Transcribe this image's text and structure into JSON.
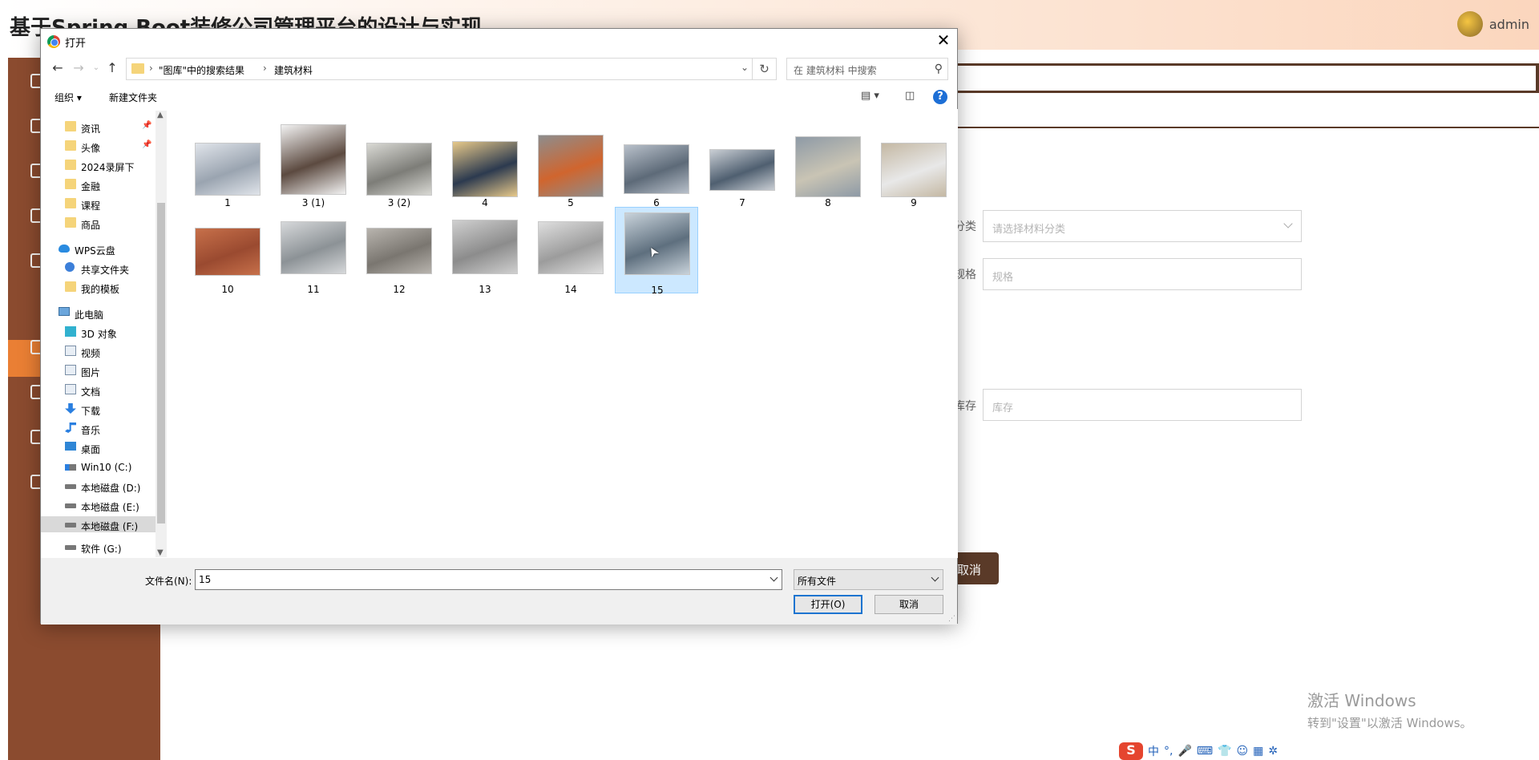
{
  "app": {
    "title": "基于Spring Boot装修公司管理平台的设计与实现",
    "user": "admin"
  },
  "form": {
    "category_label": "分类",
    "category_placeholder": "请选择材料分类",
    "spec_label": "规格",
    "spec_placeholder": "规格",
    "stock_label": "库存",
    "stock_placeholder": "库存",
    "cancel_label": "取消"
  },
  "watermark": {
    "line1": "激活 Windows",
    "line2": "转到\"设置\"以激活 Windows。"
  },
  "ime": {
    "logo": "S",
    "mode": "中",
    "punct": "°,",
    "icons": [
      "microphone-icon",
      "keyboard-icon",
      "shirt-icon",
      "robot-icon",
      "grid-icon",
      "settings-icon"
    ]
  },
  "dialog": {
    "title": "打开",
    "address": {
      "segment1": "\"图库\"中的搜索结果",
      "segment2": "建筑材料"
    },
    "search_placeholder": "在 建筑材料 中搜索",
    "toolbar": {
      "organize": "组织",
      "new_folder": "新建文件夹"
    },
    "tree": [
      {
        "label": "资讯",
        "icon": "folder-icon",
        "pinned": true
      },
      {
        "label": "头像",
        "icon": "folder-icon",
        "pinned": true
      },
      {
        "label": "2024录屏下",
        "icon": "folder-icon"
      },
      {
        "label": "金融",
        "icon": "folder-icon"
      },
      {
        "label": "课程",
        "icon": "folder-icon"
      },
      {
        "label": "商品",
        "icon": "folder-icon"
      },
      {
        "label": "WPS云盘",
        "icon": "cloud-icon"
      },
      {
        "label": "共享文件夹",
        "icon": "share-icon"
      },
      {
        "label": "我的模板",
        "icon": "folder-icon"
      },
      {
        "label": "此电脑",
        "icon": "pc-icon"
      },
      {
        "label": "3D 对象",
        "icon": "cube-icon"
      },
      {
        "label": "视频",
        "icon": "video-icon"
      },
      {
        "label": "图片",
        "icon": "pictures-icon"
      },
      {
        "label": "文档",
        "icon": "documents-icon"
      },
      {
        "label": "下载",
        "icon": "download-icon"
      },
      {
        "label": "音乐",
        "icon": "music-icon"
      },
      {
        "label": "桌面",
        "icon": "desktop-icon"
      },
      {
        "label": "Win10 (C:)",
        "icon": "system-drive-icon"
      },
      {
        "label": "本地磁盘 (D:)",
        "icon": "drive-icon"
      },
      {
        "label": "本地磁盘 (E:)",
        "icon": "drive-icon"
      },
      {
        "label": "本地磁盘 (F:)",
        "icon": "drive-icon",
        "selected": true
      },
      {
        "label": "软件 (G:)",
        "icon": "drive-icon"
      }
    ],
    "files": [
      {
        "name": "1",
        "colors": [
          "#9aa4b0",
          "#e0e4ea"
        ]
      },
      {
        "name": "3 (1)",
        "colors": [
          "#5c4a40",
          "#f2f2f2"
        ]
      },
      {
        "name": "3 (2)",
        "colors": [
          "#7d7d78",
          "#d9d9d4"
        ]
      },
      {
        "name": "4",
        "colors": [
          "#2c3a4f",
          "#e7c98a"
        ]
      },
      {
        "name": "5",
        "colors": [
          "#d0652e",
          "#8d8d8d"
        ]
      },
      {
        "name": "6",
        "colors": [
          "#5d6a78",
          "#b8c0ca"
        ]
      },
      {
        "name": "7",
        "colors": [
          "#4f5f70",
          "#c9ced4"
        ]
      },
      {
        "name": "8",
        "colors": [
          "#c9c4b4",
          "#8e9aa6"
        ]
      },
      {
        "name": "9",
        "colors": [
          "#e8e8e8",
          "#c4b8a3"
        ]
      },
      {
        "name": "10",
        "colors": [
          "#9a4a30",
          "#c7704a"
        ]
      },
      {
        "name": "11",
        "colors": [
          "#8c9296",
          "#d6d8da"
        ]
      },
      {
        "name": "12",
        "colors": [
          "#7a7670",
          "#b8b4ae"
        ]
      },
      {
        "name": "13",
        "colors": [
          "#8c8c8c",
          "#cfcfcf"
        ]
      },
      {
        "name": "14",
        "colors": [
          "#9c9c9c",
          "#dedede"
        ]
      },
      {
        "name": "15",
        "colors": [
          "#5e6f7e",
          "#c8d2da"
        ],
        "selected": true
      }
    ],
    "filename_label": "文件名(N):",
    "filename_value": "15",
    "filetype": "所有文件",
    "open_button": "打开(O)",
    "cancel_button": "取消"
  }
}
